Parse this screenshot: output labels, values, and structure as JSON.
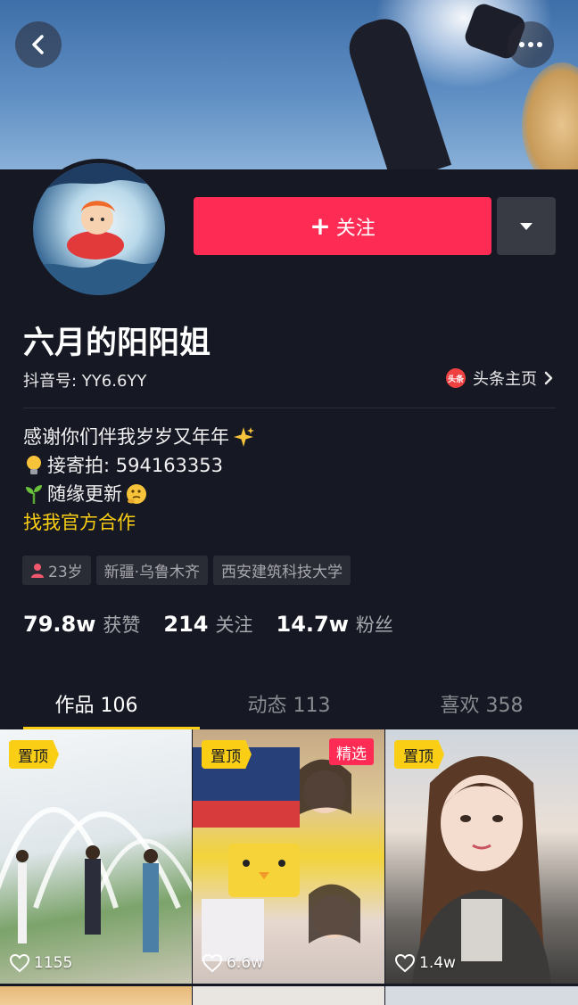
{
  "header": {
    "back_icon": "chevron-left-icon",
    "more_icon": "ellipsis-icon"
  },
  "profile": {
    "nickname": "六月的阳阳姐",
    "douyin_id": "抖音号: YY6.6YY",
    "toutiao_badge": "头条",
    "toutiao_label": "头条主页",
    "follow_label": "关注",
    "follow_color": "#fe2c55",
    "accent_color": "#face15"
  },
  "bio": {
    "line1": "感谢你们伴我岁岁又年年",
    "line2": "接寄拍: 594163353",
    "line3": "随缘更新",
    "cta": "找我官方合作"
  },
  "tags": {
    "age": "23岁",
    "location": "新疆·乌鲁木齐",
    "school": "西安建筑科技大学"
  },
  "stats": [
    {
      "value": "79.8w",
      "label": "获赞"
    },
    {
      "value": "214",
      "label": "关注"
    },
    {
      "value": "14.7w",
      "label": "粉丝"
    }
  ],
  "tabs": [
    {
      "label": "作品 106",
      "active": true
    },
    {
      "label": "动态 113",
      "active": false
    },
    {
      "label": "喜欢 358",
      "active": false
    }
  ],
  "videos": [
    {
      "pin": "置顶",
      "likes": "1155"
    },
    {
      "pin": "置顶",
      "featured": "精选",
      "likes": "6.6w"
    },
    {
      "pin": "置顶",
      "likes": "1.4w"
    }
  ]
}
